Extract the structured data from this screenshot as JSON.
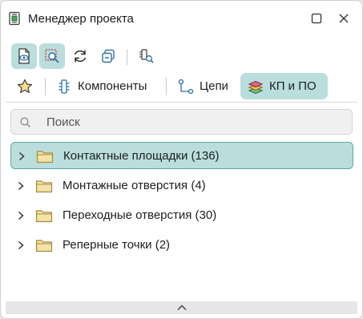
{
  "window": {
    "title": "Менеджер проекта",
    "app_icon": "project-manager-icon",
    "controls": [
      "maximize-icon",
      "close-icon"
    ]
  },
  "toolbar": {
    "buttons": [
      {
        "icon": "document-eye-icon",
        "active": true
      },
      {
        "icon": "zoom-region-icon",
        "active": true
      },
      {
        "icon": "refresh-icon",
        "active": false
      },
      {
        "icon": "copy-icon",
        "active": false
      },
      {
        "icon": "component-search-icon",
        "active": false
      }
    ]
  },
  "tabs": [
    {
      "label": "",
      "icon": "star-icon",
      "active": false
    },
    {
      "label": "Компоненты",
      "icon": "chip-icon",
      "active": false
    },
    {
      "label": "Цепи",
      "icon": "net-icon",
      "active": false
    },
    {
      "label": "КП и ПО",
      "icon": "layers-icon",
      "active": true
    }
  ],
  "search": {
    "placeholder": "Поиск",
    "value": ""
  },
  "tree": {
    "items": [
      {
        "label": "Контактные площадки (136)",
        "selected": true
      },
      {
        "label": "Монтажные отверстия (4)",
        "selected": false
      },
      {
        "label": "Переходные отверстия (30)",
        "selected": false
      },
      {
        "label": "Реперные точки (2)",
        "selected": false
      }
    ]
  },
  "colors": {
    "accent": "#b9dedd",
    "accent_border": "#5ba9a6",
    "folder": "#f3e3a8",
    "folder_stroke": "#a88a3a"
  }
}
